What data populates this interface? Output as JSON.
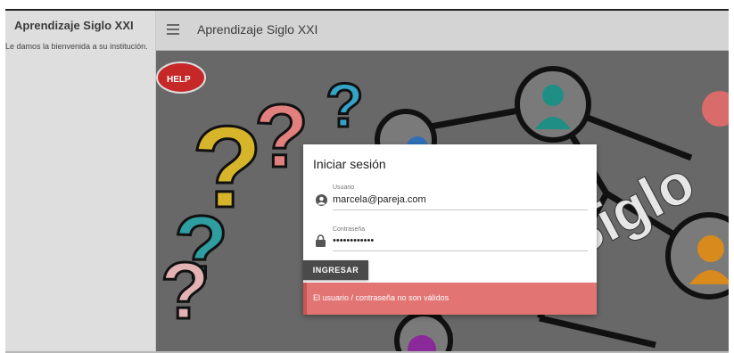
{
  "sidebar": {
    "title": "Aprendizaje Siglo XXI",
    "welcome": "Le damos la bienvenida a su institución."
  },
  "topbar": {
    "title": "Aprendizaje Siglo XXI",
    "menu_icon": "hamburger-menu-icon"
  },
  "background": {
    "help_sign": "HELP",
    "watermark_text": "Siglo"
  },
  "login": {
    "title": "Iniciar sesión",
    "user_label": "Usuario",
    "user_value": "marcela@pareja.com",
    "user_icon": "account-circle-icon",
    "password_label": "Contraseña",
    "password_value": "••••••••••••",
    "password_icon": "lock-icon",
    "submit_label": "INGRESAR",
    "error_message": "El usuario / contraseña no son válidos"
  },
  "colors": {
    "error_bg": "#e37474",
    "button_bg": "#4a4a4a"
  }
}
